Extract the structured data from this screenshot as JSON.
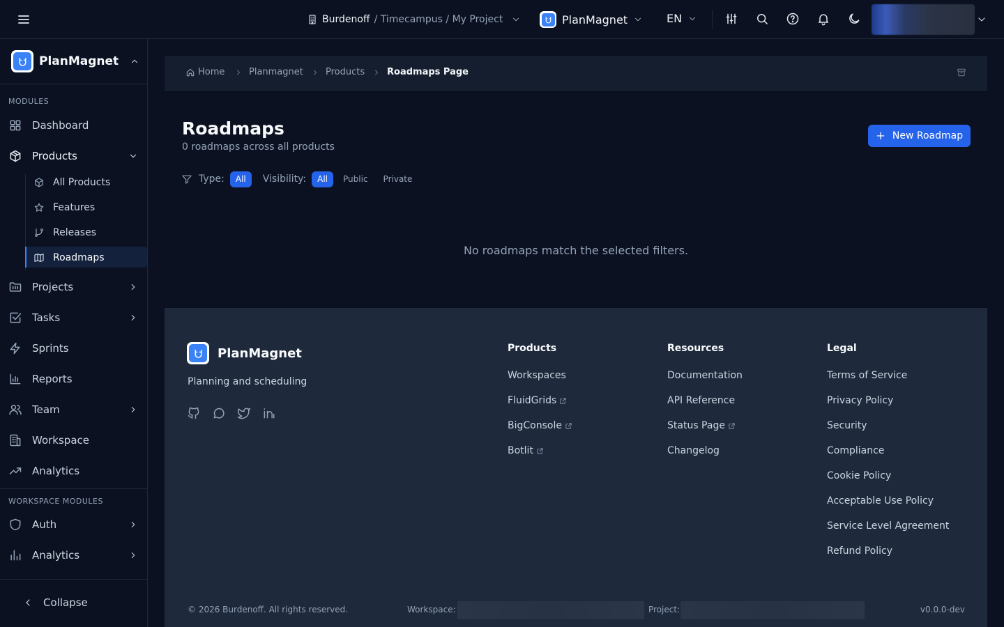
{
  "topbar": {
    "org": "Burdenoff",
    "path_rest": "/ Timecampus / My Project",
    "app_name": "PlanMagnet",
    "language": "EN"
  },
  "sidebar": {
    "brand": "PlanMagnet",
    "modules_heading": "MODULES",
    "items": [
      {
        "label": "Dashboard",
        "icon": "dashboard-icon"
      },
      {
        "label": "Products",
        "icon": "package-icon"
      },
      {
        "label": "Projects",
        "icon": "folder-icon"
      },
      {
        "label": "Tasks",
        "icon": "checkbox-icon"
      },
      {
        "label": "Sprints",
        "icon": "zap-icon"
      },
      {
        "label": "Reports",
        "icon": "bar-chart-icon"
      },
      {
        "label": "Team",
        "icon": "users-icon"
      },
      {
        "label": "Workspace",
        "icon": "building-icon"
      },
      {
        "label": "Analytics",
        "icon": "trend-icon"
      }
    ],
    "sub_items": [
      {
        "label": "All Products",
        "icon": "package-icon"
      },
      {
        "label": "Features",
        "icon": "star-icon"
      },
      {
        "label": "Releases",
        "icon": "git-branch-icon"
      },
      {
        "label": "Roadmaps",
        "icon": "map-icon"
      }
    ],
    "workspace_heading": "WORKSPACE MODULES",
    "workspace_items": [
      {
        "label": "Auth",
        "icon": "shield-icon"
      },
      {
        "label": "Analytics",
        "icon": "bar-chart-icon"
      }
    ],
    "collapse": "Collapse"
  },
  "breadcrumb": {
    "home": "Home",
    "items": [
      "Planmagnet",
      "Products"
    ],
    "current": "Roadmaps Page"
  },
  "page": {
    "title": "Roadmaps",
    "subtitle": "0 roadmaps across all products",
    "new_button": "New Roadmap",
    "filters": {
      "type_label": "Type:",
      "type_options": [
        "All"
      ],
      "type_selected": "All",
      "visibility_label": "Visibility:",
      "visibility_options": [
        "All",
        "Public",
        "Private"
      ],
      "visibility_selected": "All"
    },
    "empty_message": "No roadmaps match the selected filters."
  },
  "footer": {
    "brand": "PlanMagnet",
    "tagline": "Planning and scheduling",
    "social": [
      "github-icon",
      "chat-icon",
      "twitter-icon",
      "linkedin-icon"
    ],
    "columns": [
      {
        "heading": "Products",
        "links": [
          {
            "label": "Workspaces",
            "external": false
          },
          {
            "label": "FluidGrids",
            "external": true
          },
          {
            "label": "BigConsole",
            "external": true
          },
          {
            "label": "Botlit",
            "external": true
          }
        ]
      },
      {
        "heading": "Resources",
        "links": [
          {
            "label": "Documentation",
            "external": false
          },
          {
            "label": "API Reference",
            "external": false
          },
          {
            "label": "Status Page",
            "external": true
          },
          {
            "label": "Changelog",
            "external": false
          }
        ]
      },
      {
        "heading": "Legal",
        "links": [
          {
            "label": "Terms of Service",
            "external": false
          },
          {
            "label": "Privacy Policy",
            "external": false
          },
          {
            "label": "Security",
            "external": false
          },
          {
            "label": "Compliance",
            "external": false
          },
          {
            "label": "Cookie Policy",
            "external": false
          },
          {
            "label": "Acceptable Use Policy",
            "external": false
          },
          {
            "label": "Service Level Agreement",
            "external": false
          },
          {
            "label": "Refund Policy",
            "external": false
          }
        ]
      }
    ],
    "copyright": "© 2026 Burdenoff. All rights reserved.",
    "workspace_label": "Workspace:",
    "project_label": "Project:",
    "version": "v0.0.0-dev"
  },
  "colors": {
    "background": "#0b1120",
    "panel": "#151e2e",
    "footer": "#1e293b",
    "accent": "#2563eb",
    "text": "#e2e8f0",
    "muted": "#94a3b8"
  }
}
